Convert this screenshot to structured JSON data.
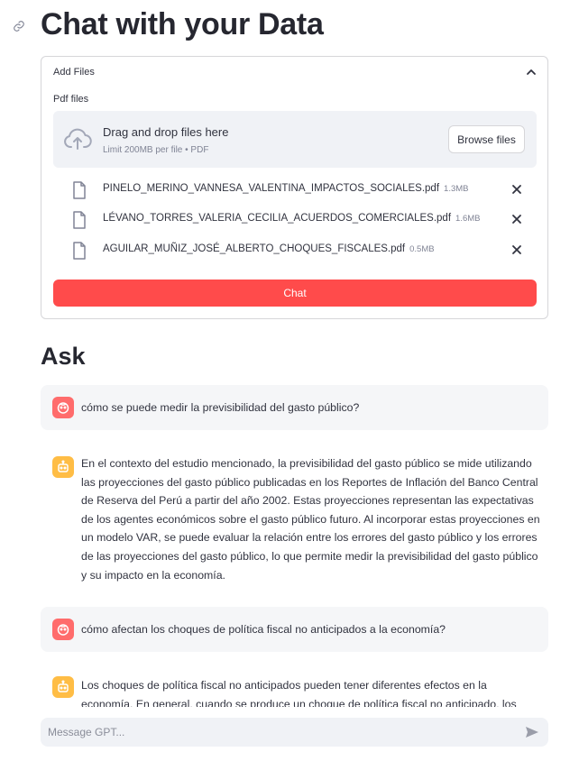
{
  "page": {
    "title": "Chat with your Data",
    "anchor_icon": "link-icon"
  },
  "uploader": {
    "header": "Add Files",
    "chevron_icon": "chevron-up-icon",
    "label": "Pdf files",
    "drop_title": "Drag and drop files here",
    "drop_hint": "Limit 200MB per file • PDF",
    "browse_label": "Browse files",
    "files": [
      {
        "name": "PINELO_MERINO_VANNESA_VALENTINA_IMPACTOS_SOCIALES.pdf",
        "size": "1.3MB"
      },
      {
        "name": "LÉVANO_TORRES_VALERIA_CECILIA_ACUERDOS_COMERCIALES.pdf",
        "size": "1.6MB"
      },
      {
        "name": "AGUILAR_MUÑIZ_JOSÉ_ALBERTO_CHOQUES_FISCALES.pdf",
        "size": "0.5MB"
      }
    ],
    "submit_label": "Chat"
  },
  "ask": {
    "heading": "Ask",
    "messages": [
      {
        "role": "user",
        "text": "cómo se puede medir la previsibilidad del gasto público?"
      },
      {
        "role": "assistant",
        "text": "En el contexto del estudio mencionado, la previsibilidad del gasto público se mide utilizando las proyecciones del gasto público publicadas en los Reportes de Inflación del Banco Central de Reserva del Perú a partir del año 2002. Estas proyecciones representan las expectativas de los agentes económicos sobre el gasto público futuro. Al incorporar estas proyecciones en un modelo VAR, se puede evaluar la relación entre los errores del gasto público y los errores de las proyecciones del gasto público, lo que permite medir la previsibilidad del gasto público y su impacto en la economía."
      },
      {
        "role": "user",
        "text": "cómo afectan los choques de política fiscal no anticipados a la economía?"
      },
      {
        "role": "assistant",
        "text": "Los choques de política fiscal no anticipados pueden tener diferentes efectos en la economía. En general, cuando se produce un choque de política fiscal no anticipado, los agentes económicos"
      }
    ]
  },
  "chat_input": {
    "placeholder": "Message GPT...",
    "send_icon": "send-icon"
  },
  "colors": {
    "primary": "#ff4b4b",
    "user_avatar": "#ff6c6c",
    "bot_avatar": "#ffbd45",
    "surface": "#f0f2f6"
  }
}
